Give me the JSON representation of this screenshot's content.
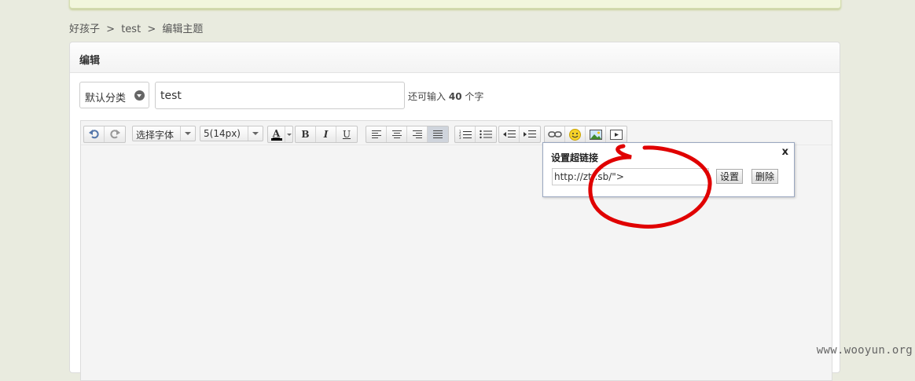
{
  "breadcrumb": [
    {
      "label": "好孩子"
    },
    {
      "sep": ">"
    },
    {
      "label": "test"
    },
    {
      "sep": ">"
    },
    {
      "label": "编辑主题"
    }
  ],
  "panel": {
    "title": "编辑",
    "category": {
      "selected": "默认分类"
    },
    "title_input": {
      "value": "test"
    },
    "char_hint": {
      "prefix": "还可输入",
      "count": "40",
      "suffix": "个字"
    }
  },
  "toolbar": {
    "font_family": "选择字体",
    "font_size": "5(14px)",
    "bold": "B",
    "italic": "I",
    "underline": "U",
    "color_letter": "A"
  },
  "link_popup": {
    "title": "设置超链接",
    "close": "x",
    "url_value": "http://zt..sb/\">",
    "set_button": "设置",
    "delete_button": "删除"
  },
  "watermark": "www.wooyun.org",
  "colors": {
    "page_bg": "#e9ebdf",
    "annotation_red": "#e00000",
    "popup_border": "#9aa7c0"
  }
}
